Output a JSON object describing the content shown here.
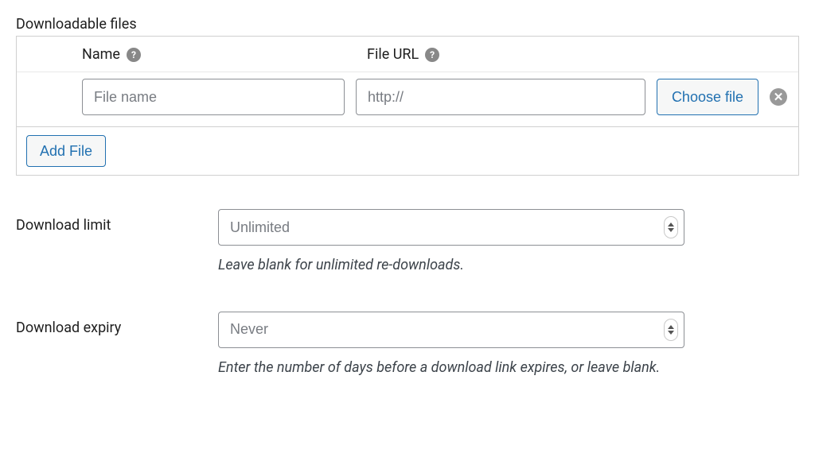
{
  "files_section": {
    "label": "Downloadable files",
    "name_header": "Name",
    "url_header": "File URL",
    "help_glyph": "?",
    "name_placeholder": "File name",
    "url_placeholder": "http://",
    "choose_file_label": "Choose file",
    "remove_glyph": "✕",
    "add_file_label": "Add File"
  },
  "download_limit": {
    "label": "Download limit",
    "placeholder": "Unlimited",
    "value": "",
    "help": "Leave blank for unlimited re-downloads."
  },
  "download_expiry": {
    "label": "Download expiry",
    "placeholder": "Never",
    "value": "",
    "help": "Enter the number of days before a download link expires, or leave blank."
  }
}
